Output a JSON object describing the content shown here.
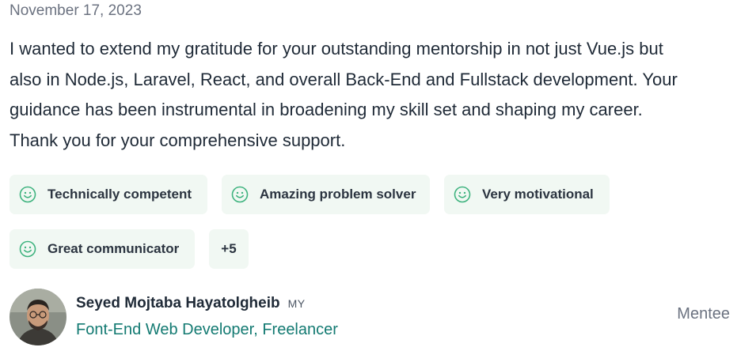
{
  "review": {
    "date": "November 17, 2023",
    "text": "I wanted to extend my gratitude for your outstanding mentorship in not just Vue.js but also in Node.js, Laravel, React, and overall Back-End and Fullstack development. Your guidance has been instrumental in broadening my skill set and shaping my career. Thank you for your comprehensive support.",
    "tags": [
      {
        "label": "Technically competent",
        "icon": "smile-icon"
      },
      {
        "label": "Amazing problem solver",
        "icon": "smile-icon"
      },
      {
        "label": "Very motivational",
        "icon": "smile-icon"
      },
      {
        "label": "Great communicator",
        "icon": "smile-icon"
      }
    ],
    "more_tags": "+5"
  },
  "author": {
    "name": "Seyed Mojtaba Hayatolgheib",
    "country": "MY",
    "title": "Font-End Web Developer, Freelancer",
    "role": "Mentee"
  },
  "colors": {
    "accent": "#137a72",
    "chip_bg": "#f1f8f3",
    "icon_green": "#3fb37f",
    "muted": "#6b7280"
  }
}
